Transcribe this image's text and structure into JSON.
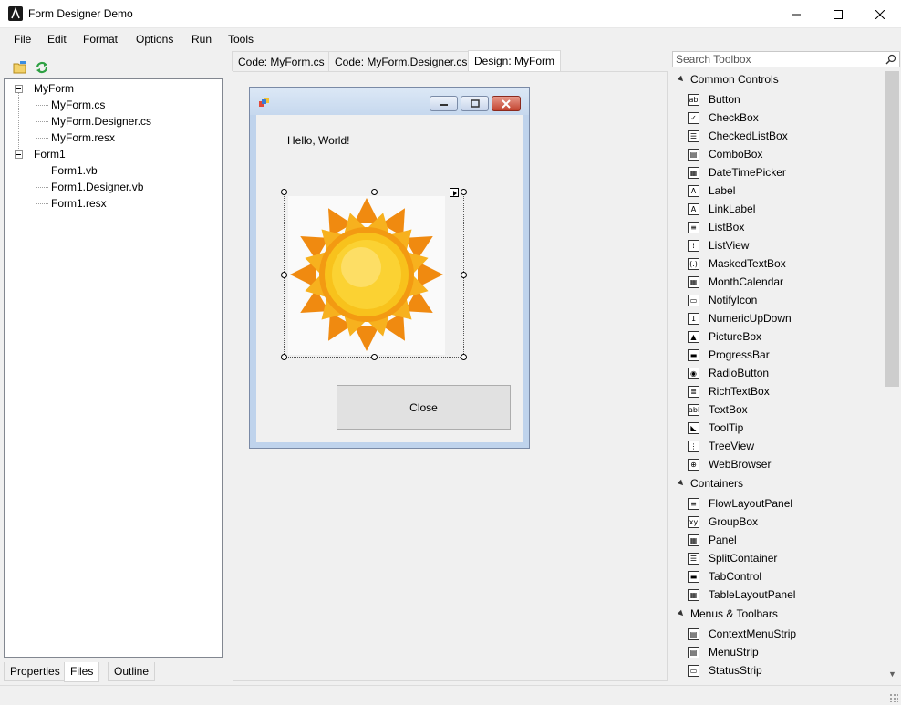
{
  "window": {
    "title": "Form Designer Demo"
  },
  "menu": [
    "File",
    "Edit",
    "Format",
    "Options",
    "Run",
    "Tools"
  ],
  "project_tree": [
    {
      "label": "MyForm",
      "children": [
        "MyForm.cs",
        "MyForm.Designer.cs",
        "MyForm.resx"
      ]
    },
    {
      "label": "Form1",
      "children": [
        "Form1.vb",
        "Form1.Designer.vb",
        "Form1.resx"
      ]
    }
  ],
  "left_tabs": {
    "properties": "Properties",
    "files": "Files",
    "outline": "Outline",
    "active": "Files"
  },
  "doc_tabs": {
    "tab1": "Code: MyForm.cs",
    "tab2": "Code: MyForm.Designer.cs",
    "tab3": "Design: MyForm",
    "active": "Design: MyForm"
  },
  "form": {
    "hello_label": "Hello, World!",
    "close_button": "Close",
    "picture": "sun-image"
  },
  "toolbox": {
    "search_placeholder": "Search Toolbox",
    "categories": [
      {
        "name": "Common Controls",
        "items": [
          {
            "label": "Button",
            "icon": "button-icon",
            "glyph": "ab"
          },
          {
            "label": "CheckBox",
            "icon": "checkbox-icon",
            "glyph": "✓"
          },
          {
            "label": "CheckedListBox",
            "icon": "checkedlistbox-icon",
            "glyph": "☰"
          },
          {
            "label": "ComboBox",
            "icon": "combobox-icon",
            "glyph": "▤"
          },
          {
            "label": "DateTimePicker",
            "icon": "datetimepicker-icon",
            "glyph": "▦"
          },
          {
            "label": "Label",
            "icon": "label-icon",
            "glyph": "A"
          },
          {
            "label": "LinkLabel",
            "icon": "linklabel-icon",
            "glyph": "A"
          },
          {
            "label": "ListBox",
            "icon": "listbox-icon",
            "glyph": "≡"
          },
          {
            "label": "ListView",
            "icon": "listview-icon",
            "glyph": "⁞"
          },
          {
            "label": "MaskedTextBox",
            "icon": "maskedtextbox-icon",
            "glyph": "(.)"
          },
          {
            "label": "MonthCalendar",
            "icon": "monthcalendar-icon",
            "glyph": "▦"
          },
          {
            "label": "NotifyIcon",
            "icon": "notifyicon-icon",
            "glyph": "▭"
          },
          {
            "label": "NumericUpDown",
            "icon": "numericupdown-icon",
            "glyph": "1"
          },
          {
            "label": "PictureBox",
            "icon": "picturebox-icon",
            "glyph": "▲"
          },
          {
            "label": "ProgressBar",
            "icon": "progressbar-icon",
            "glyph": "▬"
          },
          {
            "label": "RadioButton",
            "icon": "radiobutton-icon",
            "glyph": "◉"
          },
          {
            "label": "RichTextBox",
            "icon": "richtextbox-icon",
            "glyph": "≣"
          },
          {
            "label": "TextBox",
            "icon": "textbox-icon",
            "glyph": "abl"
          },
          {
            "label": "ToolTip",
            "icon": "tooltip-icon",
            "glyph": "◣"
          },
          {
            "label": "TreeView",
            "icon": "treeview-icon",
            "glyph": "⋮"
          },
          {
            "label": "WebBrowser",
            "icon": "webbrowser-icon",
            "glyph": "⊕"
          }
        ]
      },
      {
        "name": "Containers",
        "items": [
          {
            "label": "FlowLayoutPanel",
            "icon": "flowlayoutpanel-icon",
            "glyph": "≡"
          },
          {
            "label": "GroupBox",
            "icon": "groupbox-icon",
            "glyph": "xy"
          },
          {
            "label": "Panel",
            "icon": "panel-icon",
            "glyph": "▦"
          },
          {
            "label": "SplitContainer",
            "icon": "splitcontainer-icon",
            "glyph": "☰"
          },
          {
            "label": "TabControl",
            "icon": "tabcontrol-icon",
            "glyph": "▬"
          },
          {
            "label": "TableLayoutPanel",
            "icon": "tablelayoutpanel-icon",
            "glyph": "▦"
          }
        ]
      },
      {
        "name": "Menus & Toolbars",
        "items": [
          {
            "label": "ContextMenuStrip",
            "icon": "contextmenustrip-icon",
            "glyph": "▤"
          },
          {
            "label": "MenuStrip",
            "icon": "menustrip-icon",
            "glyph": "▤"
          },
          {
            "label": "StatusStrip",
            "icon": "statusstrip-icon",
            "glyph": "▭"
          }
        ]
      }
    ]
  }
}
